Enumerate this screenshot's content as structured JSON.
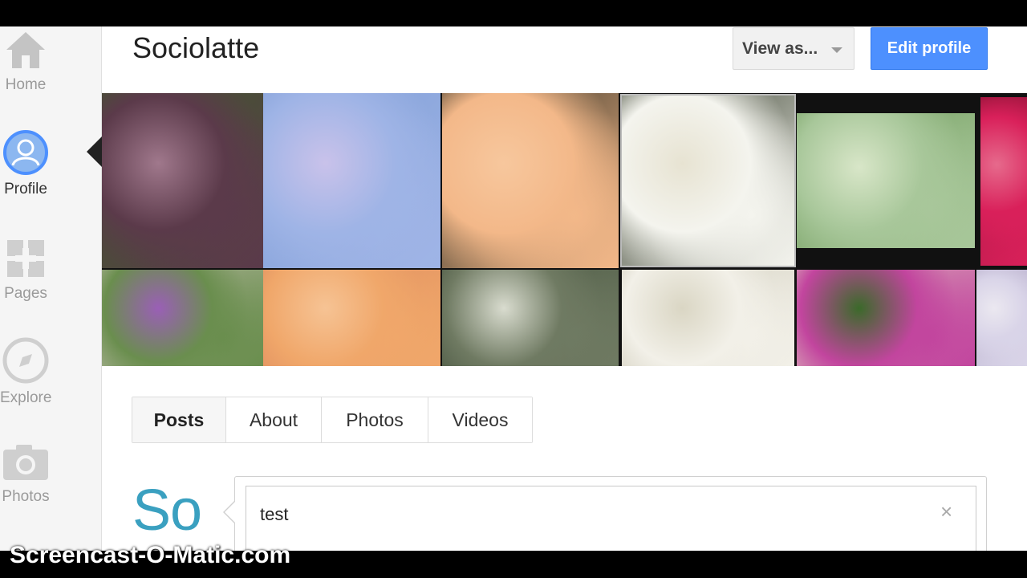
{
  "leftnav": {
    "items": [
      {
        "label": "Home",
        "icon": "home-icon"
      },
      {
        "label": "Profile",
        "icon": "profile-icon",
        "active": true
      },
      {
        "label": "Pages",
        "icon": "pages-icon"
      },
      {
        "label": "Explore",
        "icon": "compass-icon"
      },
      {
        "label": "Photos",
        "icon": "camera-icon"
      }
    ]
  },
  "header": {
    "title": "Sociolatte",
    "view_as_label": "View as...",
    "edit_profile_label": "Edit profile"
  },
  "cover": {
    "photos": [
      {
        "name": "lupine-flowers-photo",
        "colors": [
          "#5b3a4a",
          "#a0788c",
          "#3e5a2c"
        ]
      },
      {
        "name": "hydrangea-photo",
        "colors": [
          "#9fb4e6",
          "#c9c2ea",
          "#7f9ed6"
        ]
      },
      {
        "name": "daylily-photo",
        "colors": [
          "#f3b889",
          "#f7c79d",
          "#2a2a1f"
        ]
      },
      {
        "name": "white-orchid-photo",
        "colors": [
          "#f4f4ee",
          "#e7e3d2",
          "#2b3320"
        ]
      },
      {
        "name": "frangipani-photo",
        "colors": [
          "#a8c79a",
          "#d8e6c8",
          "#6e9a5a"
        ]
      },
      {
        "name": "pink-flower-photo",
        "colors": [
          "#d9205a",
          "#e66a8c",
          "#8a1234"
        ]
      },
      {
        "name": "purple-flowers-photo",
        "colors": [
          "#6a8e4e",
          "#9a5fb6",
          "#c9c3b6"
        ]
      },
      {
        "name": "peach-rose-photo",
        "colors": [
          "#f0a76a",
          "#f6c394",
          "#d9855c"
        ]
      },
      {
        "name": "garden-plants-photo",
        "colors": [
          "#6f7a62",
          "#d9dccf",
          "#3c4a36"
        ]
      },
      {
        "name": "white-blossom-photo",
        "colors": [
          "#f2f0e8",
          "#dad6c4",
          "#c7c3b0"
        ]
      },
      {
        "name": "zinnia-butterfly-photo",
        "colors": [
          "#c2459e",
          "#3b6a2a",
          "#e6e0c6"
        ]
      },
      {
        "name": "pale-flower-photo",
        "colors": [
          "#d9d4e8",
          "#ebe8f0",
          "#b9b0cc"
        ]
      }
    ]
  },
  "tabs": [
    {
      "label": "Posts",
      "active": true
    },
    {
      "label": "About"
    },
    {
      "label": "Photos"
    },
    {
      "label": "Videos"
    }
  ],
  "post": {
    "avatar_text": "So",
    "input_value": "test",
    "close_glyph": "×"
  },
  "watermark": "Screencast-O-Matic.com",
  "colors": {
    "accent_blue": "#4d90fe",
    "avatar_teal": "#3aa0c0"
  }
}
